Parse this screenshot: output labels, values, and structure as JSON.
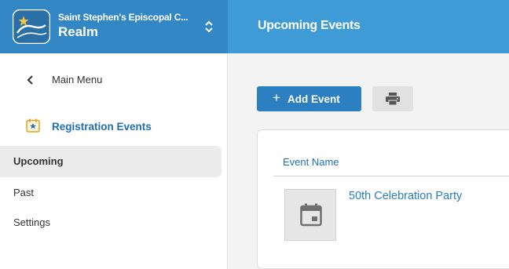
{
  "org": {
    "name": "Saint Stephen's Episcopal C...",
    "app": "Realm"
  },
  "sidebar": {
    "back_label": "Main Menu",
    "section_label": "Registration Events",
    "items": [
      {
        "label": "Upcoming",
        "active": true
      },
      {
        "label": "Past",
        "active": false
      },
      {
        "label": "Settings",
        "active": false
      }
    ]
  },
  "header": {
    "title": "Upcoming Events"
  },
  "toolbar": {
    "add_icon": "+",
    "add_label": "Add Event",
    "print_icon": "printer-icon"
  },
  "table": {
    "columns": [
      "Event Name"
    ],
    "rows": [
      {
        "thumbnail_icon": "calendar-icon",
        "name": "50th Celebration Party"
      }
    ]
  },
  "colors": {
    "org_header": "#3387c4",
    "page_header": "#3e9bd6",
    "accent": "#2c7fc0",
    "link": "#2a7dbf"
  }
}
